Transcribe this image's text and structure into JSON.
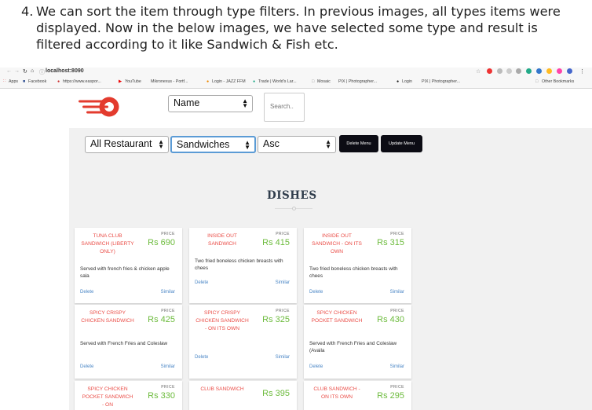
{
  "caption": {
    "number": "4.",
    "text": "We can sort the item through type filters. In previous images, all types items were displayed. Now in the below images, we have selected some type and result is filtered according to it like Sandwich & Fish etc."
  },
  "browser": {
    "url": "localhost:8090",
    "bookmarks": [
      "Apps",
      "Facebook",
      "https://www.easpor...",
      "YouTube",
      "Mikronexus - Portf...",
      "Login - JAZZ FFM",
      "Trade | World's Lar...",
      "Mosaic",
      "PIX | Photographer...",
      "Login",
      "PIX | Photographer...",
      "Other Bookmarks"
    ]
  },
  "topbar": {
    "sort_field": "Name",
    "search_placeholder": "Search.."
  },
  "filters": {
    "restaurant": "All Restaurant",
    "type": "Sandwiches",
    "order": "Asc",
    "delete_menu": "Delete Menu",
    "update_menu": "Update Menu"
  },
  "section_title": "DISHES",
  "price_label": "PRICE",
  "delete_label": "Delete",
  "similar_label": "Similar",
  "dishes": [
    {
      "name": "TUNA CLUB SANDWICH (LIBERTY ONLY)",
      "price": "Rs 690",
      "desc": "Served with french fries & chicken apple sala"
    },
    {
      "name": "INSIDE OUT SANDWICH",
      "price": "Rs 415",
      "desc": "Two fried boneless chicken breasts with chees"
    },
    {
      "name": "INSIDE OUT SANDWICH - ON ITS OWN",
      "price": "Rs 315",
      "desc": "Two fried boneless chicken breasts with chees"
    },
    {
      "name": "SPICY CRISPY CHICKEN SANDWICH",
      "price": "Rs 425",
      "desc": "Served with French Fries and Coleslaw"
    },
    {
      "name": "SPICY CRISPY CHICKEN SANDWICH - ON ITS OWN",
      "price": "Rs 325",
      "desc": ""
    },
    {
      "name": "SPICY CHICKEN POCKET SANDWICH",
      "price": "Rs 430",
      "desc": "Served with French Fries and Coleslaw (Availa"
    },
    {
      "name": "SPICY CHICKEN POCKET SANDWICH - ON",
      "price": "Rs 330",
      "desc": ""
    },
    {
      "name": "CLUB SANDWICH",
      "price": "Rs 395",
      "desc": ""
    },
    {
      "name": "CLUB SANDWICH - ON ITS OWN",
      "price": "Rs 295",
      "desc": ""
    }
  ]
}
